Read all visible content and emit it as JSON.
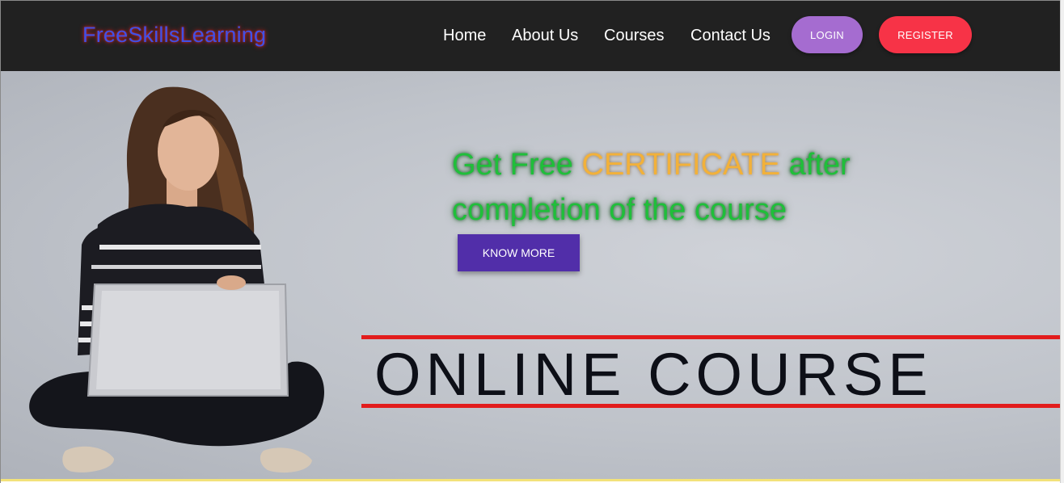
{
  "brand": "FreeSkillsLearning",
  "nav": {
    "links": [
      "Home",
      "About Us",
      "Courses",
      "Contact Us"
    ],
    "login_label": "LOGIN",
    "register_label": "REGISTER"
  },
  "hero": {
    "headline_prefix": "Get Free ",
    "headline_highlight": "CERTIFICATE",
    "headline_suffix": " after completion of the course",
    "cta_label": "KNOW MORE",
    "banner_text": "ONLINE COURSE"
  },
  "colors": {
    "navbar": "#212121",
    "brand": "#3f51e6",
    "login": "#a56cd0",
    "register": "#f73347",
    "headline": "#1fbf3a",
    "highlight": "#f2b13a",
    "cta": "#512ea9",
    "banner_lines": "#e21c1c"
  }
}
